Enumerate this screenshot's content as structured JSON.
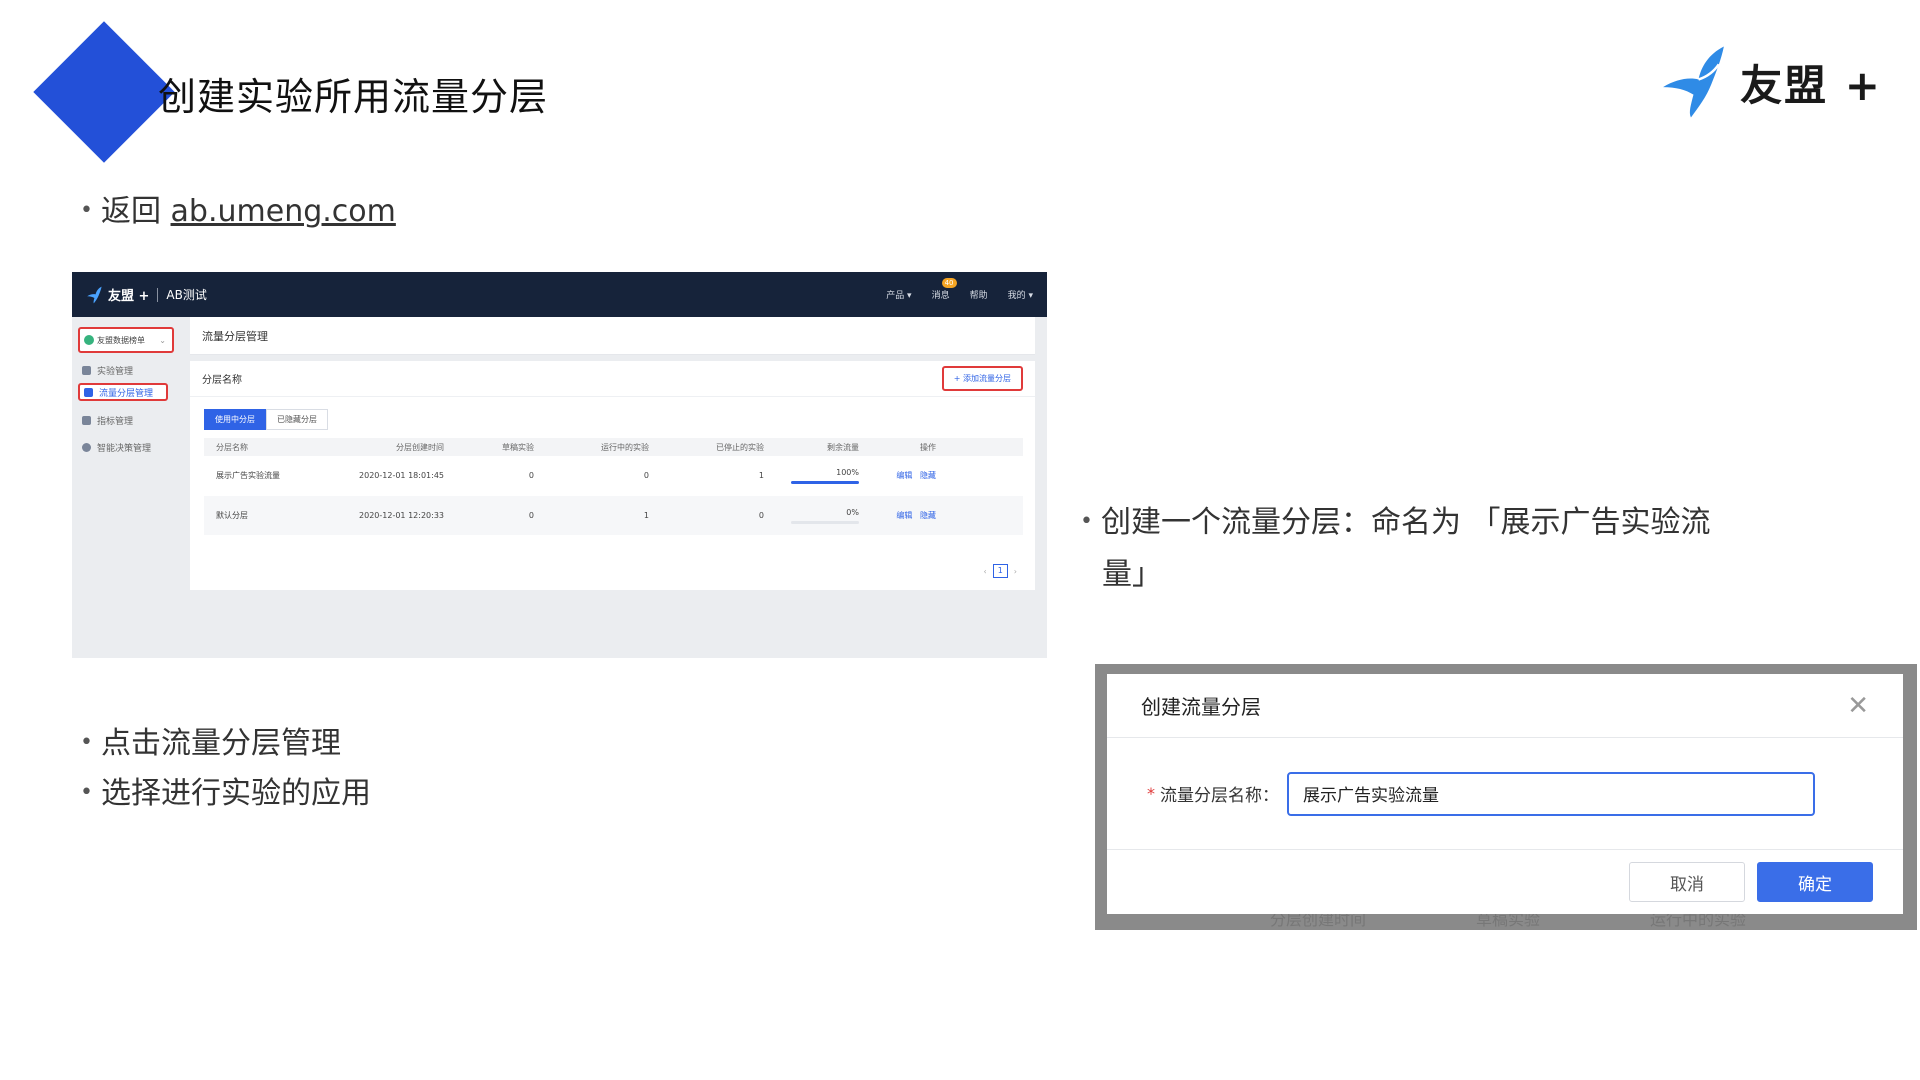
{
  "slide": {
    "title": "创建实验所用流量分层",
    "brand": "友盟 +",
    "bullets": {
      "return_prefix": "返回",
      "return_link": "ab.umeng.com",
      "click_layer": "点击流量分层管理",
      "choose_app": "选择进行实验的应用",
      "create_line1": "创建一个流量分层：命名为 「展示广告实验流",
      "create_line2": "量」"
    }
  },
  "colors": {
    "accent": "#2350d8",
    "app_blue": "#2f63e6",
    "highlight_red": "#e03a3a",
    "topbar": "#16233a"
  },
  "app": {
    "brand": "友盟 +",
    "product": "AB测试",
    "top_nav": {
      "products": "产品 ▾",
      "messages": "消息",
      "message_badge": "40",
      "help": "帮助",
      "me": "我的 ▾"
    },
    "app_select": "友盟数据榜单",
    "sidebar": [
      {
        "label": "实验管理",
        "icon": "user-icon"
      },
      {
        "label": "流量分层管理",
        "icon": "layers-icon"
      },
      {
        "label": "指标管理",
        "icon": "chart-icon"
      },
      {
        "label": "智能决策管理",
        "icon": "brain-icon"
      }
    ],
    "page_title": "流量分层管理",
    "section_title": "分层名称",
    "add_button": "+ 添加流量分层",
    "tabs": [
      "使用中分层",
      "已隐藏分层"
    ],
    "columns": [
      "分层名称",
      "分层创建时间",
      "草稿实验",
      "运行中的实验",
      "已停止的实验",
      "剩余流量",
      "操作"
    ],
    "rows": [
      {
        "name": "展示广告实验流量",
        "created": "2020-12-01 18:01:45",
        "draft": "0",
        "running": "0",
        "stopped": "1",
        "remaining": "100%",
        "remaining_value": 100,
        "edit": "编辑",
        "hide": "隐藏"
      },
      {
        "name": "默认分层",
        "created": "2020-12-01 12:20:33",
        "draft": "0",
        "running": "1",
        "stopped": "0",
        "remaining": "0%",
        "remaining_value": 0,
        "edit": "编辑",
        "hide": "隐藏"
      }
    ],
    "pager": {
      "prev": "‹",
      "page": "1",
      "next": "›"
    }
  },
  "dialog": {
    "title": "创建流量分层",
    "close": "✕",
    "field_label": "流量分层名称：",
    "required_mark": "*",
    "field_value": "展示广告实验流量",
    "cancel": "取消",
    "confirm": "确定",
    "behind_text": [
      "分层创建时间",
      "草稿实验",
      "运行中的实验"
    ]
  }
}
